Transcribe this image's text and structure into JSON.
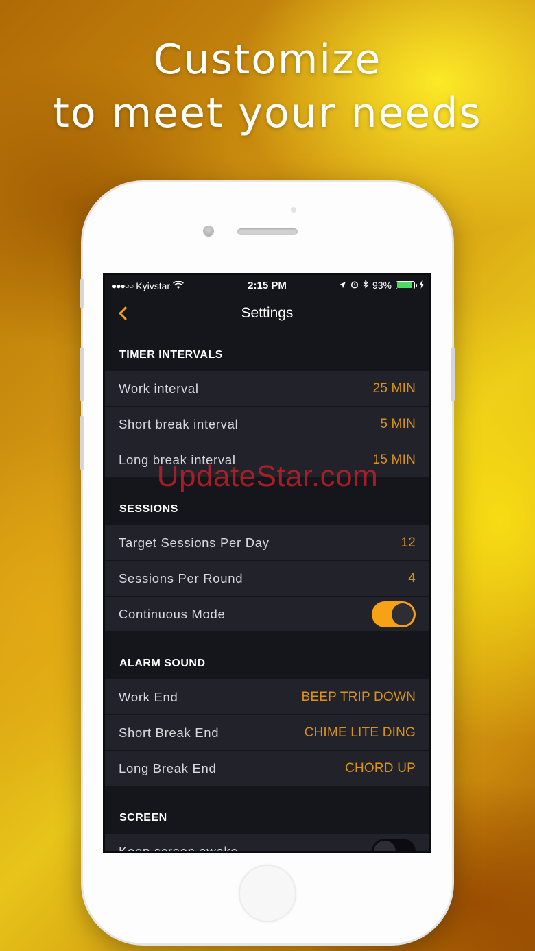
{
  "headline": {
    "line1": "Customize",
    "line2": "to meet your needs"
  },
  "status_bar": {
    "signal": "●●●○○",
    "carrier": "Kyivstar",
    "wifi_icon": "wifi-icon",
    "time": "2:15 PM",
    "battery_percent": "93%",
    "battery_level": 0.93
  },
  "nav": {
    "back_icon": "chevron-left-icon",
    "title": "Settings"
  },
  "sections": {
    "timer_intervals": {
      "header": "TIMER INTERVALS",
      "rows": [
        {
          "label": "Work interval",
          "value": "25 MIN"
        },
        {
          "label": "Short break interval",
          "value": "5 MIN"
        },
        {
          "label": "Long break interval",
          "value": "15 MIN"
        }
      ]
    },
    "sessions": {
      "header": "SESSIONS",
      "rows": [
        {
          "label": "Target Sessions Per Day",
          "value": "12"
        },
        {
          "label": "Sessions Per Round",
          "value": "4"
        },
        {
          "label": "Continuous Mode",
          "toggle": true
        }
      ]
    },
    "alarm_sound": {
      "header": "ALARM SOUND",
      "rows": [
        {
          "label": "Work End",
          "value": "BEEP TRIP DOWN"
        },
        {
          "label": "Short Break End",
          "value": "CHIME LITE DING"
        },
        {
          "label": "Long Break End",
          "value": "CHORD UP"
        }
      ]
    },
    "screen": {
      "header": "SCREEN",
      "rows": [
        {
          "label": "Keep screen awake",
          "toggle": false
        }
      ]
    }
  },
  "watermark": "UpdateStar.com",
  "colors": {
    "accent": "#f7a214",
    "value_text": "#d9921c",
    "row_bg": "#22222b",
    "screen_bg": "#15151c"
  }
}
